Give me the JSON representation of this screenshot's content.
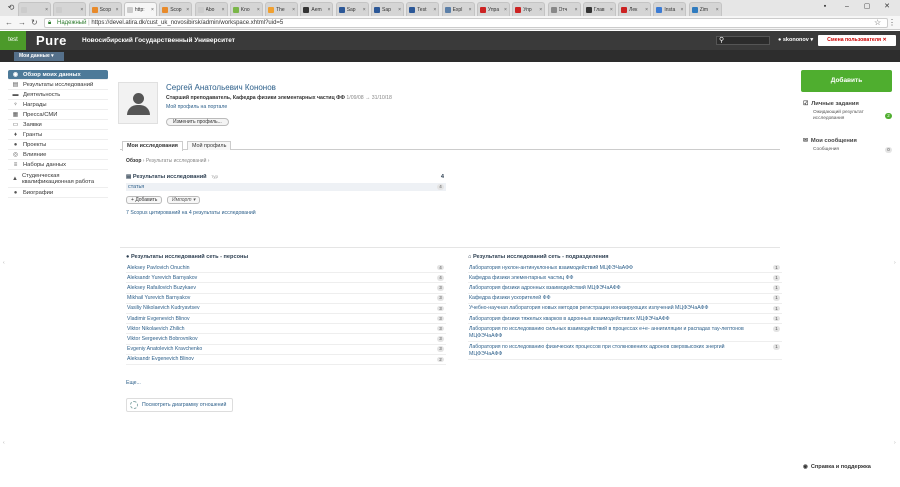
{
  "browser": {
    "tabs": [
      {
        "label": "",
        "color": "#cccccc"
      },
      {
        "label": "",
        "color": "#cccccc"
      },
      {
        "label": "Scop",
        "color": "#e88a2a"
      },
      {
        "label": "http:",
        "color": "#cccccc"
      },
      {
        "label": "Scop",
        "color": "#e88a2a"
      },
      {
        "label": "Abo",
        "color": "#cccccc"
      },
      {
        "label": "Kno",
        "color": "#7ab648"
      },
      {
        "label": "The",
        "color": "#f0a030"
      },
      {
        "label": "Aem",
        "color": "#333333"
      },
      {
        "label": "Sap",
        "color": "#2b5797"
      },
      {
        "label": "Sap",
        "color": "#2b5797"
      },
      {
        "label": "Test",
        "color": "#2b5797"
      },
      {
        "label": "Expl",
        "color": "#5b7fa8"
      },
      {
        "label": "Упра",
        "color": "#cc2222"
      },
      {
        "label": "Упр",
        "color": "#cc2222"
      },
      {
        "label": "Отч",
        "color": "#888888"
      },
      {
        "label": "Глав",
        "color": "#333333"
      },
      {
        "label": "Лек",
        "color": "#cc2222"
      },
      {
        "label": "Insta",
        "color": "#3b7bd4"
      },
      {
        "label": "Zim",
        "color": "#2f7bbf"
      }
    ],
    "secure_label": "Надежный",
    "url": "https://devel.atira.dk/cust_uk_novosibirsk/admin/workspace.xhtml?uid=5"
  },
  "header": {
    "env_badge": "test",
    "brand": "Pure",
    "university": "Новосибирский Государственный Университет",
    "user": "skononov",
    "change_user": "Смена пользователя"
  },
  "subheader": {
    "my_data": "Мои данные"
  },
  "sidebar": {
    "items": [
      {
        "label": "Обзор моих данных",
        "icon": "overview-icon",
        "glyph": "◉",
        "active": true
      },
      {
        "label": "Результаты исследований",
        "icon": "book-icon",
        "glyph": "▤"
      },
      {
        "label": "Деятельность",
        "icon": "briefcase-icon",
        "glyph": "▬"
      },
      {
        "label": "Награды",
        "icon": "trophy-icon",
        "glyph": "♆"
      },
      {
        "label": "Пресса/СМИ",
        "icon": "newspaper-icon",
        "glyph": "▦"
      },
      {
        "label": "Заявки",
        "icon": "application-icon",
        "glyph": "▭"
      },
      {
        "label": "Гранты",
        "icon": "money-bag-icon",
        "glyph": "♦"
      },
      {
        "label": "Проекты",
        "icon": "project-icon",
        "glyph": "●"
      },
      {
        "label": "Влияние",
        "icon": "impact-icon",
        "glyph": "◎"
      },
      {
        "label": "Наборы данных",
        "icon": "dataset-icon",
        "glyph": "≡"
      },
      {
        "label": "Студенческая квалификационная работа",
        "icon": "graduation-icon",
        "glyph": "▲",
        "tall": true
      },
      {
        "label": "Биографии",
        "icon": "globe-icon",
        "glyph": "●"
      }
    ]
  },
  "profile": {
    "name": "Сергей Анатольевич Кононов",
    "role": "Старший преподаватель, Кафедра физики элементарных частиц ФФ",
    "dates": "1/09/08 → 31/10/18",
    "portal_link": "Мой профиль на портале",
    "edit_button": "Изменить профиль..."
  },
  "tabs": {
    "research": "Мои исследования",
    "profile": "Мой профиль"
  },
  "breadcrumb": {
    "overview": "Обзор",
    "current": "Результаты исследований"
  },
  "research": {
    "title": "Результаты исследований",
    "type_hint": "тур",
    "total": "4",
    "rows": [
      {
        "label": "статья",
        "count": "4"
      }
    ],
    "add_button": "Добавить",
    "import_button": "Импорт",
    "scopus_text": "7 Scopus цитирований на 4 результаты исследований"
  },
  "network_persons": {
    "title": "Результаты исследований сеть - персоны",
    "items": [
      {
        "name": "Aleksey Pavlovich Onuchin",
        "count": "4"
      },
      {
        "name": "Aleksandr Yurevich Barnyakov",
        "count": "4"
      },
      {
        "name": "Aleksey Rafailovich Buzykaev",
        "count": "3"
      },
      {
        "name": "Mikhail Yurevich Barnyakov",
        "count": "3"
      },
      {
        "name": "Vasiliy Nikolaevich Kudryavtsev",
        "count": "3"
      },
      {
        "name": "Vladimir Evgenevich Blinov",
        "count": "3"
      },
      {
        "name": "Viktor Nikolaevich Zhilich",
        "count": "3"
      },
      {
        "name": "Viktor Sergeevich Bobrovnikov",
        "count": "3"
      },
      {
        "name": "Evgeniy Anatolevich Kravchenko",
        "count": "3"
      },
      {
        "name": "Aleksandr Evgenevich Blinov",
        "count": "2"
      }
    ],
    "more": "Еще...",
    "graph_button": "Посмотреть диаграмму отношений"
  },
  "network_units": {
    "title": "Результаты исследований сеть - подразделения",
    "items": [
      {
        "name": "Лаборатория нуклон-антинуклонных взаимодействий МЦФЭЧаАФФ",
        "count": "1"
      },
      {
        "name": "Кафедра физики элементарных частиц ФФ",
        "count": "1"
      },
      {
        "name": "Лаборатория физики адронных взаимодействий МЦФЭЧаАФФ",
        "count": "1"
      },
      {
        "name": "Кафедра физики ускорителей ФФ",
        "count": "1"
      },
      {
        "name": "Учебно-научная лаборатория новых методов регистрации ионизирующих излучений МЦФЭЧаАФФ",
        "count": "1"
      },
      {
        "name": "Лаборатория физики тяжелых кварков в адронных взаимодействиях МЦФЭЧаАФФ",
        "count": "1"
      },
      {
        "name": "Лаборатория по исследованию сильных взаимодействий в процессах е+е- аннигиляции и распадах тау-лептонов МЦФЭЧаАФФ",
        "count": "1",
        "tall": true
      },
      {
        "name": "Лаборатория по исследованию физических процессов при столкновениях адронов сверхвысоких энергий МЦФЭЧаАФФ",
        "count": "1",
        "tall": true
      }
    ]
  },
  "right_panel": {
    "add_button": "Добавить",
    "tasks_title": "Личные задания",
    "tasks_item": "Ожидающий результат исследования",
    "tasks_count": "2",
    "messages_title": "Мои сообщения",
    "messages_item": "Сообщения",
    "messages_count": "0",
    "help": "Справка и поддержка"
  }
}
